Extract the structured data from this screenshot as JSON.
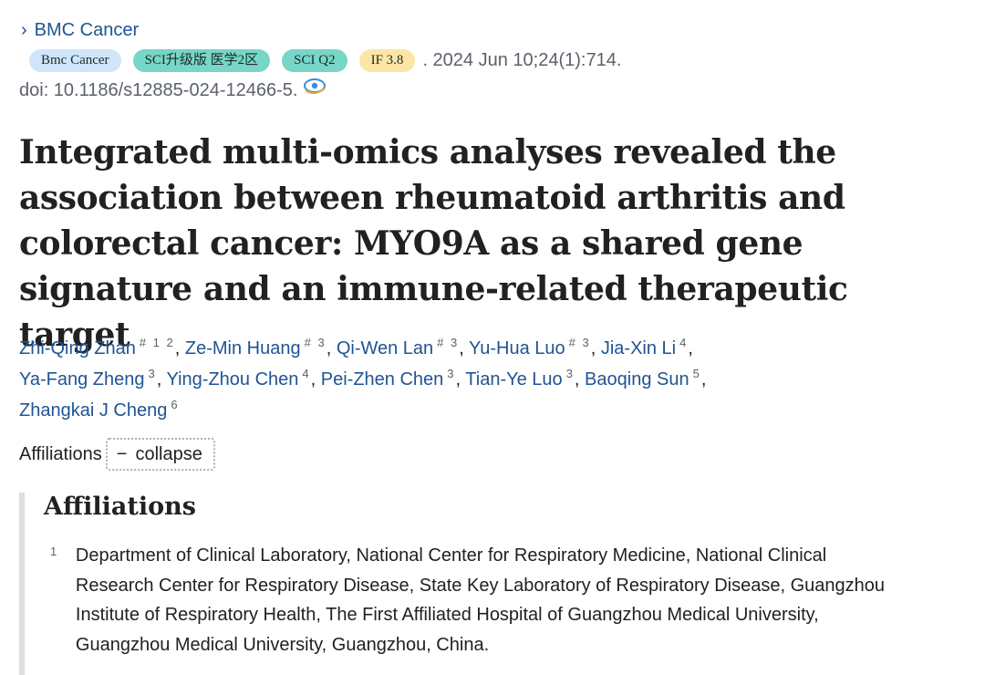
{
  "journal_link": {
    "chevron": "›",
    "label": "BMC Cancer"
  },
  "chips": {
    "journal": "Bmc Cancer",
    "zone": "SCI升级版 医学2区",
    "quartile": "SCI Q2",
    "impact": "IF 3.8"
  },
  "citation": ". 2024 Jun 10;24(1):714.",
  "doi": "doi: 10.1186/s12885-024-12466-5.",
  "doi_icon": "eye-link-icon",
  "title": "Integrated multi-omics analyses revealed the association between rheumatoid arthritis and colorectal cancer: MYO9A as a shared gene signature and an immune-related therapeutic target",
  "authors": [
    {
      "name": "Zhi-Qing Zhan",
      "sup": "# 1 2"
    },
    {
      "name": "Ze-Min Huang",
      "sup": "# 3"
    },
    {
      "name": "Qi-Wen Lan",
      "sup": "# 3"
    },
    {
      "name": "Yu-Hua Luo",
      "sup": "# 3"
    },
    {
      "name": "Jia-Xin Li",
      "sup": "4"
    },
    {
      "name": "Ya-Fang Zheng",
      "sup": "3"
    },
    {
      "name": "Ying-Zhou Chen",
      "sup": "4"
    },
    {
      "name": "Pei-Zhen Chen",
      "sup": "3"
    },
    {
      "name": "Tian-Ye Luo",
      "sup": "3"
    },
    {
      "name": "Baoqing Sun",
      "sup": "5"
    },
    {
      "name": "Zhangkai J Cheng",
      "sup": "6"
    }
  ],
  "affiliations_toggle": {
    "label": "Affiliations",
    "button_symbol": "−",
    "button_label": "collapse"
  },
  "affiliations_panel": {
    "heading": "Affiliations",
    "items": [
      {
        "num": "1",
        "text": "Department of Clinical Laboratory, National Center for Respiratory Medicine, National Clinical Research Center for Respiratory Disease, State Key Laboratory of Respiratory Disease, Guangzhou Institute of Respiratory Health, The First Affiliated Hospital of Guangzhou Medical University, Guangzhou Medical University, Guangzhou, China."
      }
    ]
  },
  "colors": {
    "link": "#205493",
    "text": "#212121",
    "muted": "#5b616b",
    "chip_blue": "#cfe6fa",
    "chip_teal": "#77d6c7",
    "chip_yellow": "#fde6a5"
  }
}
